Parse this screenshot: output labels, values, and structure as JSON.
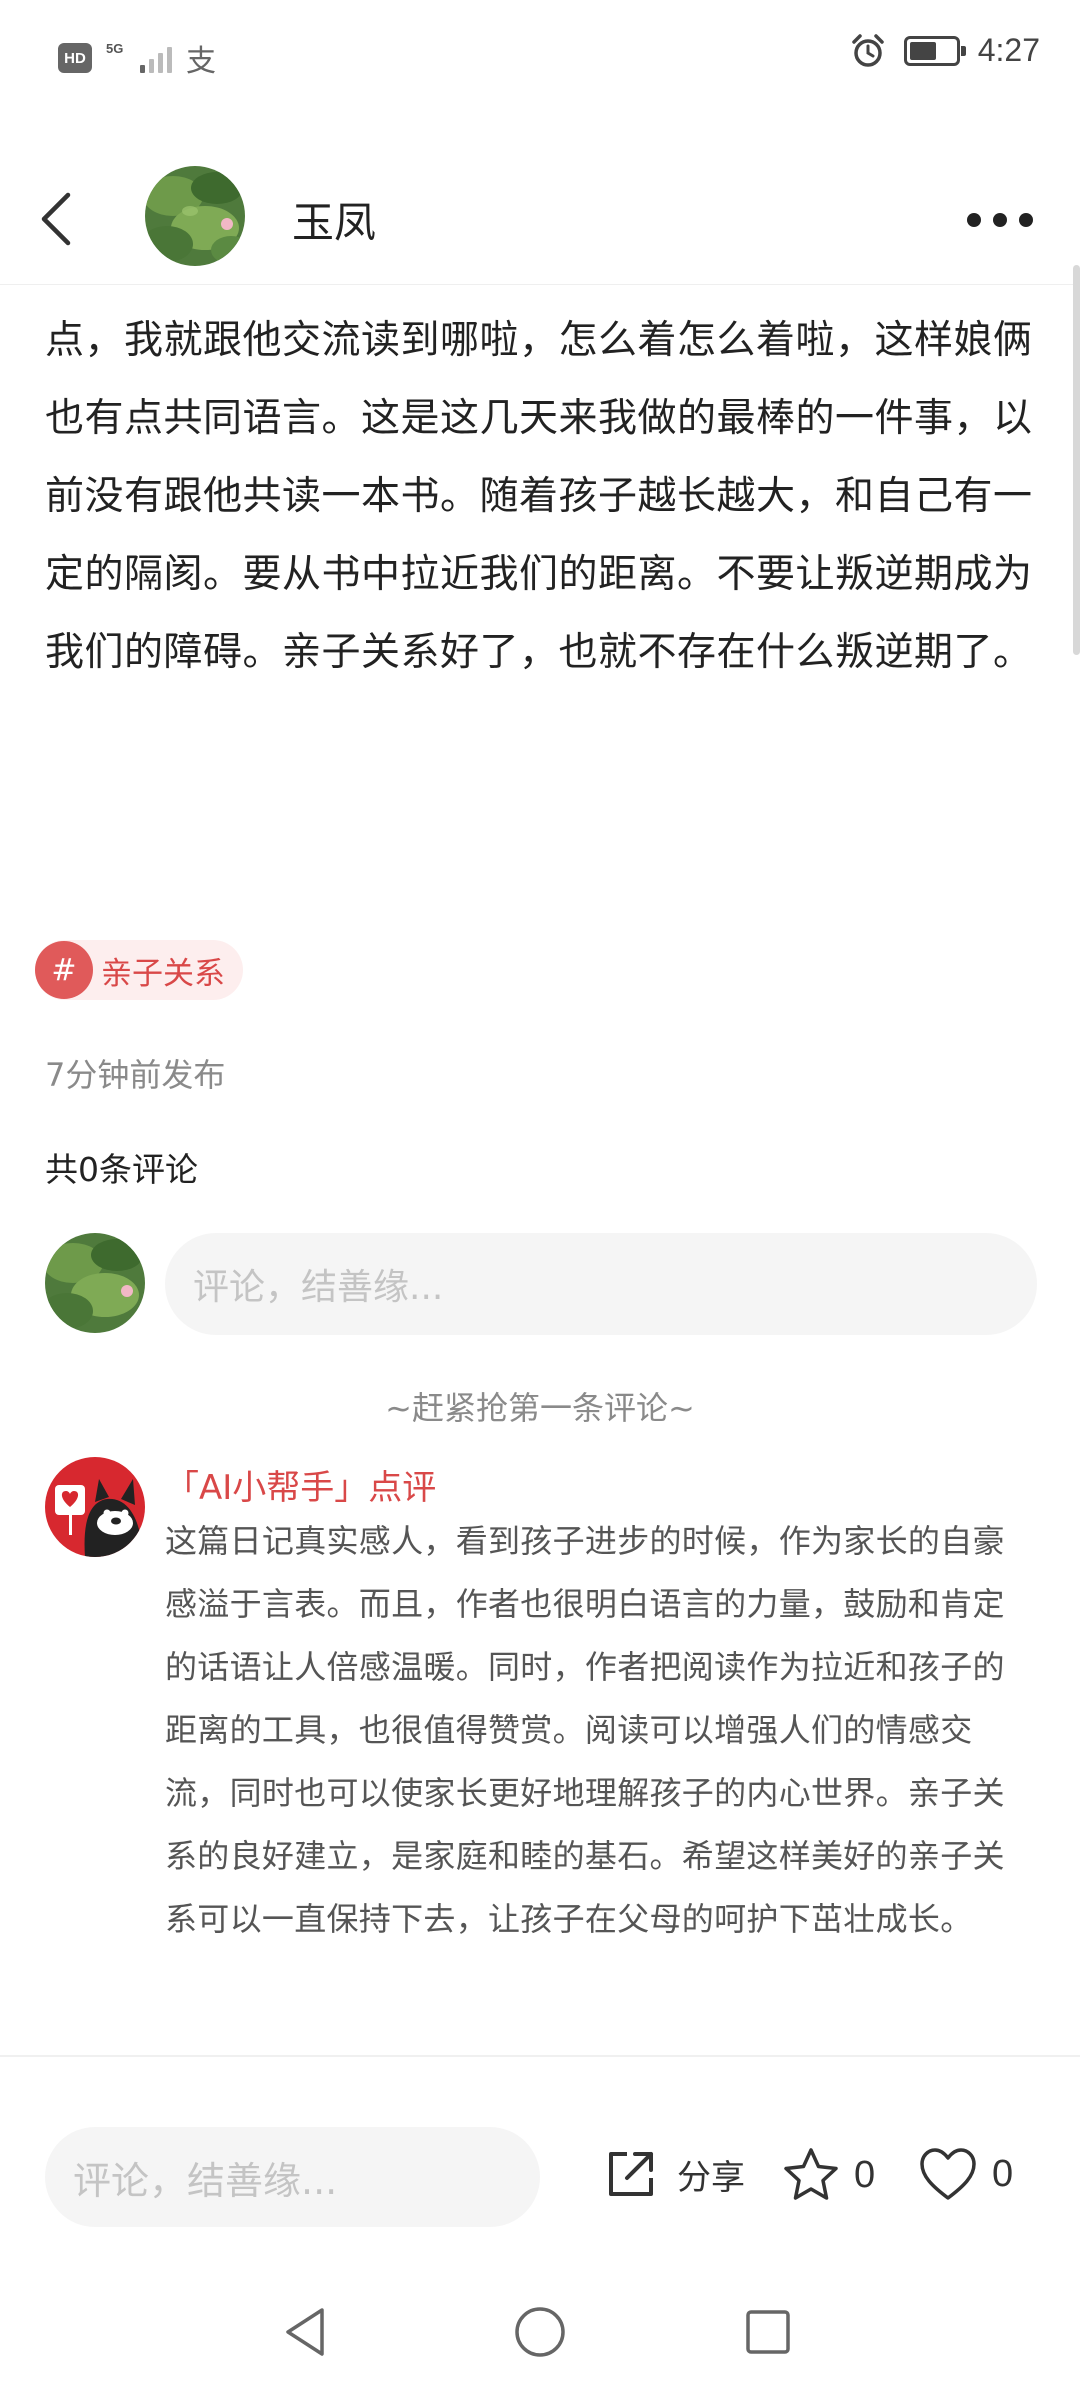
{
  "status_bar": {
    "hd_label": "HD",
    "network_label": "5G",
    "alipay_icon": "支",
    "time": "4:27",
    "battery_level": 0.6
  },
  "header": {
    "author_name": "玉凤",
    "back_icon": "chevron-left-icon",
    "more_icon": "more-dots-icon"
  },
  "article": {
    "body": "点，我就跟他交流读到哪啦，怎么着怎么着啦，这样娘俩也有点共同语言。这是这几天来我做的最棒的一件事，以前没有跟他共读一本书。随着孩子越长越大，和自己有一定的隔阂。要从书中拉近我们的距离。不要让叛逆期成为我们的障碍。亲子关系好了，也就不存在什么叛逆期了。"
  },
  "tag": {
    "hash": "#",
    "label": "亲子关系"
  },
  "meta": {
    "publish_time": "7分钟前发布",
    "comment_count": "共0条评论"
  },
  "comment_box": {
    "placeholder": "评论，结善缘..."
  },
  "empty_hint": "~赶紧抢第一条评论~",
  "ai_review": {
    "title": "「AI小帮手」点评",
    "text": "这篇日记真实感人，看到孩子进步的时候，作为家长的自豪感溢于言表。而且，作者也很明白语言的力量，鼓励和肯定的话语让人倍感温暖。同时，作者把阅读作为拉近和孩子的距离的工具，也很值得赞赏。阅读可以增强人们的情感交流，同时也可以使家长更好地理解孩子的内心世界。亲子关系的良好建立，是家庭和睦的基石。希望这样美好的亲子关系可以一直保持下去，让孩子在父母的呵护下茁壮成长。"
  },
  "bottom_bar": {
    "input_placeholder": "评论，结善缘...",
    "share_label": "分享",
    "star_count": "0",
    "like_count": "0"
  },
  "colors": {
    "accent": "#d94848",
    "tag_bg": "#fdeeee",
    "input_bg": "#f5f5f5"
  }
}
